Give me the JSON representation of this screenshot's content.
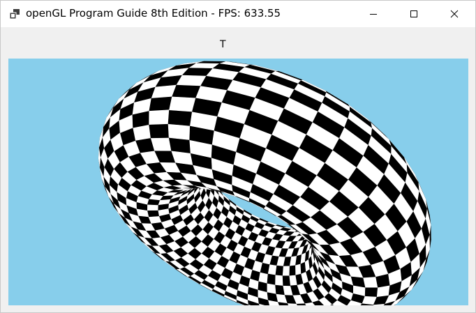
{
  "window": {
    "title": "openGL Program Guide 8th Edition - FPS: 633.55"
  },
  "toolbar": {
    "label": "T"
  },
  "viewport": {
    "background_color": "#87ceeb",
    "object": "torus",
    "texture": "checkerboard",
    "colors": [
      "#000000",
      "#ffffff"
    ]
  },
  "icons": {
    "app": "app-icon",
    "minimize": "minimize-icon",
    "maximize": "maximize-icon",
    "close": "close-icon"
  }
}
